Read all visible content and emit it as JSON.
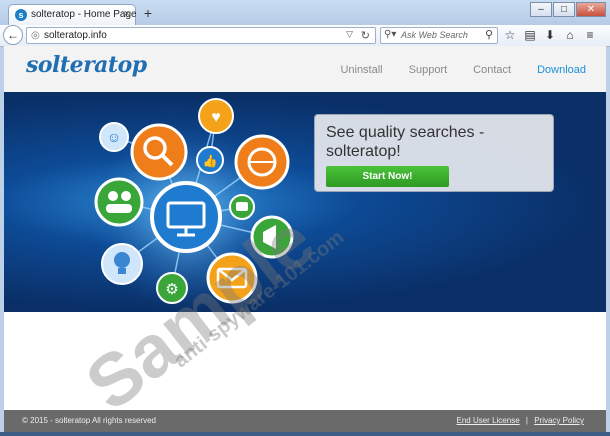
{
  "browser": {
    "tab_title": "solteratop - Home Page",
    "tab_close": "×",
    "new_tab": "+",
    "window_buttons": [
      "–",
      "□",
      "✕"
    ],
    "url": "solteratop.info",
    "search_placeholder": "Ask Web Search"
  },
  "site": {
    "logo": "solteratop",
    "nav": [
      {
        "label": "Uninstall"
      },
      {
        "label": "Support"
      },
      {
        "label": "Contact"
      },
      {
        "label": "Download"
      }
    ],
    "promo": {
      "headline": "See quality searches - solteratop!",
      "cta": "Start Now!"
    },
    "footer": {
      "copyright": "© 2015 - solteratop All rights reserved",
      "eula": "End User License",
      "separator": "|",
      "privacy": "Privacy Policy"
    }
  },
  "watermark": {
    "main": "Sample",
    "sub": "anti-spyware-101.com"
  },
  "colors": {
    "accent": "#1f90d8",
    "cta_green": "#3fb22e",
    "hero_blue": "#0d4a95"
  },
  "icons": [
    "favicon-icon",
    "back-icon",
    "globe-icon",
    "reload-icon",
    "search-icon",
    "star-icon",
    "clipboard-icon",
    "download-icon",
    "home-icon",
    "menu-icon",
    "smiley-icon",
    "magnifier-icon",
    "heart-icon",
    "thumbs-up-icon",
    "globe-network-icon",
    "users-icon",
    "monitor-icon",
    "chat-icon",
    "megaphone-icon",
    "lightbulb-icon",
    "gear-icon",
    "mail-icon"
  ]
}
